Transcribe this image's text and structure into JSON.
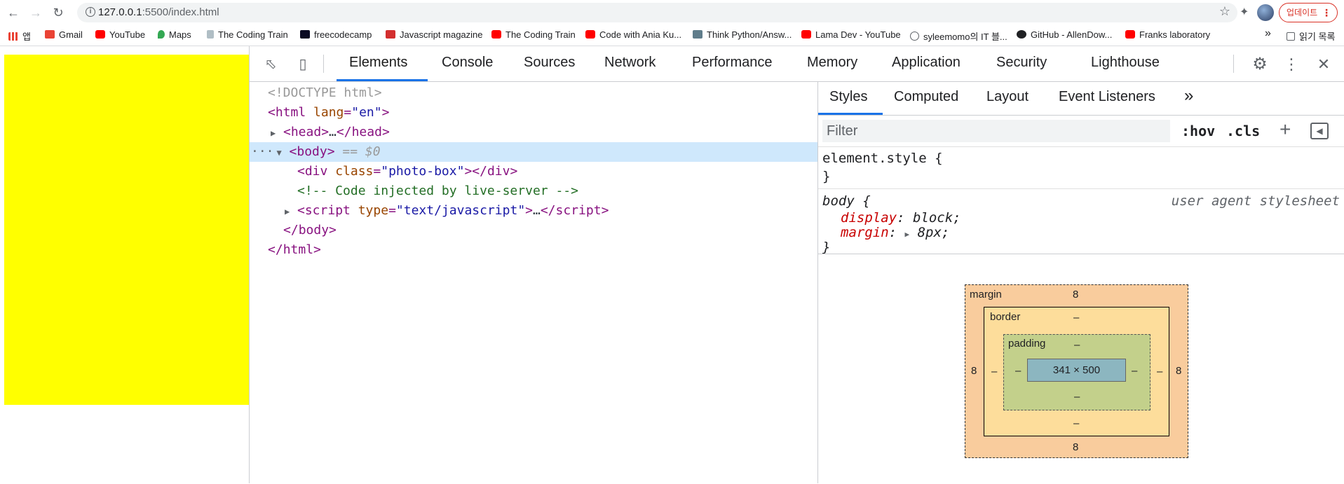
{
  "browser": {
    "url_host": "127.0.0.1",
    "url_path": ":5500/index.html",
    "update_label": "업데이트"
  },
  "bookmarks": [
    {
      "label": "앱",
      "icon": "apps-grid-icon",
      "color": "#4285f4"
    },
    {
      "label": "Gmail",
      "icon": "gmail-icon",
      "color": "#ea4335"
    },
    {
      "label": "YouTube",
      "icon": "youtube-icon",
      "color": "#ff0000"
    },
    {
      "label": "Maps",
      "icon": "maps-pin-icon",
      "color": "#34a853"
    },
    {
      "label": "The Coding Train",
      "icon": "coding-train-icon",
      "color": "#b0bec5"
    },
    {
      "label": "freecodecamp",
      "icon": "freecodecamp-icon",
      "color": "#0a0a23"
    },
    {
      "label": "Javascript magazine",
      "icon": "js-magazine-icon",
      "color": "#d32f2f"
    },
    {
      "label": "The Coding Train",
      "icon": "youtube-icon",
      "color": "#ff0000"
    },
    {
      "label": "Code with Ania Ku...",
      "icon": "youtube-icon",
      "color": "#ff0000"
    },
    {
      "label": "Think Python/Answ...",
      "icon": "think-python-icon",
      "color": "#607d8b"
    },
    {
      "label": "Lama Dev - YouTube",
      "icon": "youtube-icon",
      "color": "#ff0000"
    },
    {
      "label": "syleemomo의 IT 블...",
      "icon": "globe-icon",
      "color": "#5f6368"
    },
    {
      "label": "GitHub - AllenDow...",
      "icon": "github-icon",
      "color": "#202124"
    },
    {
      "label": "Franks laboratory",
      "icon": "youtube-icon",
      "color": "#ff0000"
    }
  ],
  "bookmarks_overflow": "»",
  "reading_list": "읽기 목록",
  "devtools": {
    "tabs": [
      "Elements",
      "Console",
      "Sources",
      "Network",
      "Performance",
      "Memory",
      "Application",
      "Security",
      "Lighthouse"
    ],
    "active_tab": "Elements",
    "elements": {
      "doctype": "<!DOCTYPE html>",
      "html_open_tag": "html",
      "html_attr_name": "lang",
      "html_attr_value": "\"en\"",
      "head": "head",
      "head_ellipsis": "…",
      "body": "body",
      "selected_marker": "== $0",
      "div_tag": "div",
      "div_attr_name": "class",
      "div_attr_value": "\"photo-box\"",
      "comment": "<!-- Code injected by live-server -->",
      "script_tag": "script",
      "script_attr_name": "type",
      "script_attr_value": "\"text/javascript\"",
      "script_ellipsis": "…",
      "dots": "···"
    },
    "styles": {
      "tabs": [
        "Styles",
        "Computed",
        "Layout",
        "Event Listeners"
      ],
      "more_tabs": "»",
      "filter_placeholder": "Filter",
      "hov": ":hov",
      "cls": ".cls",
      "plus": "+",
      "element_style_selector": "element.style {",
      "close_brace": "}",
      "body_selector": "body",
      "open_brace": " {",
      "user_agent": "user agent stylesheet",
      "props": [
        {
          "name": "display",
          "value": "block;"
        },
        {
          "name": "margin",
          "value": "8px;"
        }
      ]
    },
    "box_model": {
      "margin_label": "margin",
      "border_label": "border",
      "padding_label": "padding",
      "margin_top": "8",
      "margin_bottom": "8",
      "margin_left": "8",
      "margin_right": "8",
      "border_top": "–",
      "border_bottom": "–",
      "border_left": "–",
      "border_right": "–",
      "padding_top": "–",
      "padding_bottom": "–",
      "padding_left": "–",
      "padding_right": "–",
      "content_size": "341 × 500"
    }
  }
}
